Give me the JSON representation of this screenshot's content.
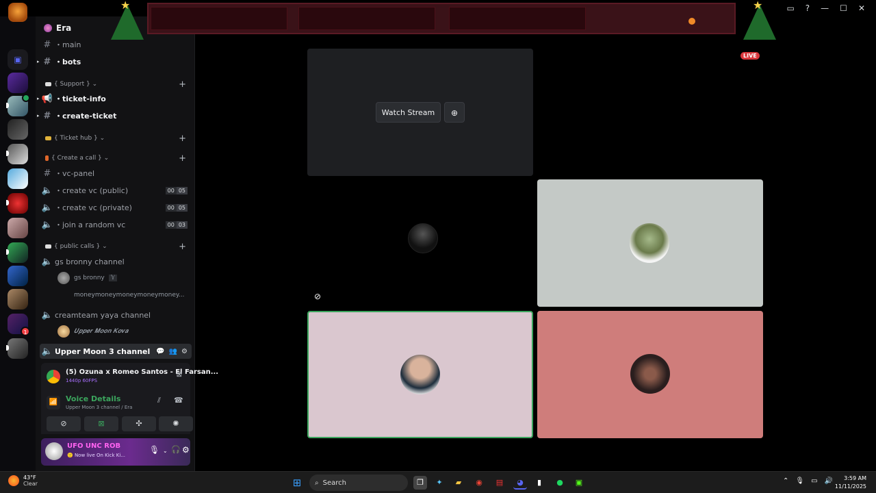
{
  "server": {
    "name": "Era"
  },
  "channels": [
    {
      "name": "・main",
      "type": "text"
    },
    {
      "name": "・bots",
      "type": "text"
    }
  ],
  "categories": {
    "support": "{ Support }",
    "ticket_hub": "{ Ticket hub }",
    "create_call": "{ Create a call }",
    "public_calls": "{ public calls }"
  },
  "support_channels": [
    "・ticket-info",
    "・create-ticket"
  ],
  "call_channels": [
    {
      "name": "・vc-panel",
      "type": "text"
    },
    {
      "name": "・create vc (public)",
      "type": "voice",
      "count_a": "00",
      "count_b": "05"
    },
    {
      "name": "・create vc (private)",
      "type": "voice",
      "count_a": "00",
      "count_b": "05"
    },
    {
      "name": "・join a random vc",
      "type": "voice",
      "count_a": "00",
      "count_b": "03"
    }
  ],
  "public_calls": {
    "ch1": "gs bronny channel",
    "ch1_users": [
      "gs bronny",
      "moneymoneymoneymoneymoney..."
    ],
    "ch1_user_tag": "𝕐",
    "ch2": "creamteam yaya channel",
    "ch2_users": [
      "𝑼𝒑𝒑𝒆𝒓 𝑴𝒐𝒐𝒏 𝑲𝒐𝒗𝒂"
    ],
    "ch3": "Upper Moon 3 channel"
  },
  "activity": {
    "title": "(5) Ozuna x Romeo Santos - El Farsan...",
    "subtitle": "1440p 60FPS"
  },
  "voice": {
    "title": "Voice Details",
    "subtitle": "Upper Moon 3 channel / Era"
  },
  "user": {
    "name": "UFO UNC ROB",
    "status": "🙂 Now live On Kick Ki..."
  },
  "stream": {
    "live_label": "LIVE",
    "watch_label": "Watch Stream"
  },
  "taskbar": {
    "temp": "43°F",
    "condition": "Clear",
    "search": "Search",
    "time": "3:59 AM",
    "date": "11/11/2025",
    "discord_badge": "1"
  },
  "rail_badge": "1",
  "colors": {
    "accent_green": "#3ba55d",
    "live_red": "#da373c",
    "tile_grey": "#c4c9c6",
    "tile_pink": "#dac7cf",
    "tile_rose": "#cf7d7b"
  }
}
